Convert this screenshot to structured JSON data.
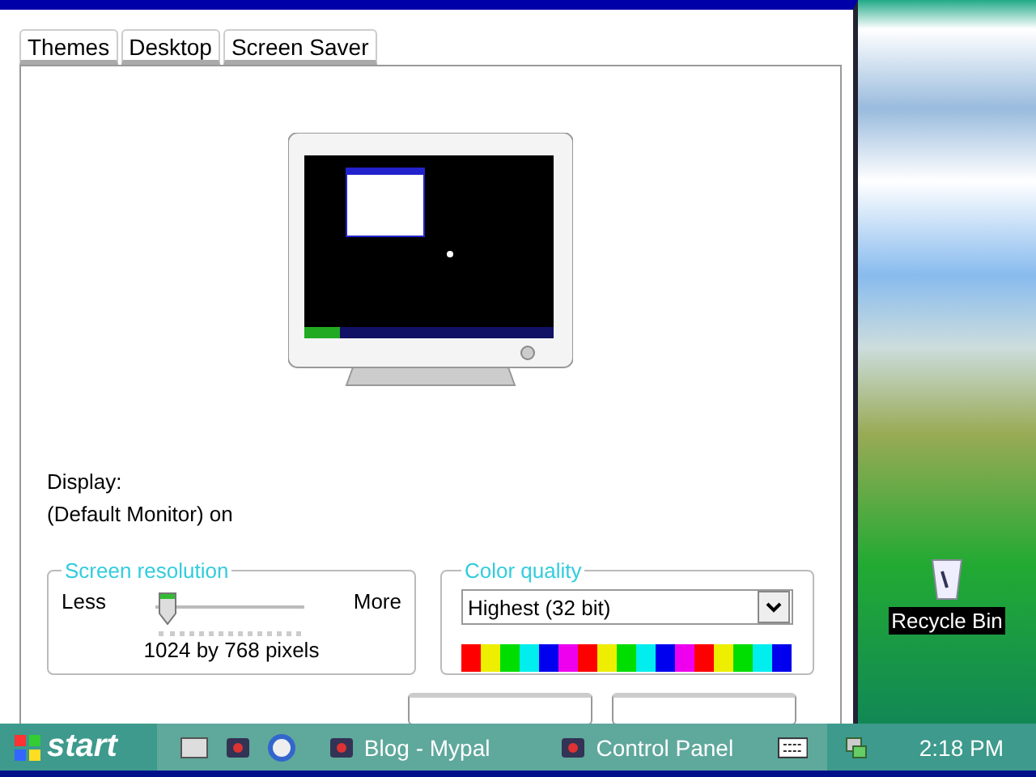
{
  "tabs": [
    {
      "label": "Themes",
      "selected": false
    },
    {
      "label": "Desktop",
      "selected": false
    },
    {
      "label": "Screen Saver",
      "selected": false
    }
  ],
  "display": {
    "label": "Display:",
    "value": "(Default Monitor) on"
  },
  "screen_resolution": {
    "title": "Screen resolution",
    "less": "Less",
    "more": "More",
    "level": 0.08,
    "reading": "1024 by 768 pixels"
  },
  "color_quality": {
    "title": "Color quality",
    "value": "Highest (32 bit)"
  },
  "desktop_icons": [
    {
      "label": "Recycle Bin"
    }
  ],
  "taskbar": {
    "start": "start",
    "tasks": [
      {
        "label": "Blog - Mypal"
      },
      {
        "label": "Control Panel"
      }
    ],
    "clock": "2:18 PM"
  }
}
